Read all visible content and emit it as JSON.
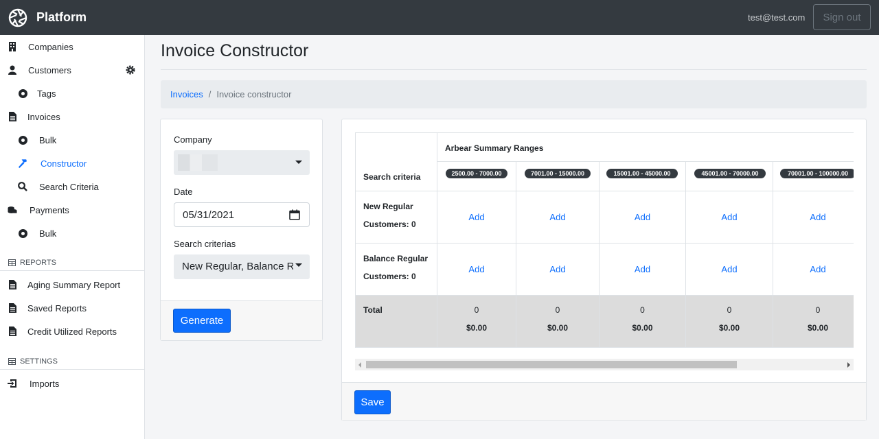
{
  "app": {
    "name": "Platform",
    "logo_icon": "aperture-icon"
  },
  "header": {
    "user_email": "test@test.com",
    "signout_label": "Sign out"
  },
  "sidebar": {
    "items": [
      {
        "label": "Companies",
        "icon": "building-icon"
      },
      {
        "label": "Customers",
        "icon": "user-icon",
        "settings_icon": "gear-icon"
      },
      {
        "label": "Tags",
        "icon": "circle-dot-icon"
      },
      {
        "label": "Invoices",
        "icon": "file-icon"
      },
      {
        "label": "Bulk",
        "icon": "circle-dot-icon"
      },
      {
        "label": "Constructor",
        "icon": "hammer-icon",
        "active": true
      },
      {
        "label": "Search Criteria",
        "icon": "search-icon"
      },
      {
        "label": "Payments",
        "icon": "coins-icon"
      },
      {
        "label": "Bulk",
        "icon": "circle-dot-icon"
      }
    ],
    "reports_heading": "REPORTS",
    "reports": [
      {
        "label": "Aging Summary Report",
        "icon": "file-icon"
      },
      {
        "label": "Saved Reports",
        "icon": "file-icon"
      },
      {
        "label": "Credit Utilized Reports",
        "icon": "file-icon"
      }
    ],
    "settings_heading": "SETTINGS",
    "settings": [
      {
        "label": "Imports",
        "icon": "import-icon"
      }
    ]
  },
  "page": {
    "title": "Invoice Constructor",
    "breadcrumb": {
      "parent": "Invoices",
      "separator": "/",
      "current": "Invoice constructor"
    }
  },
  "form": {
    "company_label": "Company",
    "company_value": "",
    "date_label": "Date",
    "date_value": "05/31/2021",
    "criteria_label": "Search criterias",
    "criteria_value": "New Regular, Balance Regular",
    "generate_label": "Generate"
  },
  "table": {
    "criteria_header": "Search criteria",
    "ranges_header": "Arbear Summary Ranges",
    "ranges": [
      "2500.00 - 7000.00",
      "7001.00 - 15000.00",
      "15001.00 - 45000.00",
      "45001.00 - 70000.00",
      "70001.00 - 100000.00"
    ],
    "rows": [
      {
        "name": "New Regular",
        "customers_label": "Customers: 0",
        "cells": [
          "Add",
          "Add",
          "Add",
          "Add",
          "Add"
        ]
      },
      {
        "name": "Balance Regular",
        "customers_label": "Customers: 0",
        "cells": [
          "Add",
          "Add",
          "Add",
          "Add",
          "Add"
        ]
      }
    ],
    "total_label": "Total",
    "totals": [
      {
        "count": "0",
        "amount": "$0.00"
      },
      {
        "count": "0",
        "amount": "$0.00"
      },
      {
        "count": "0",
        "amount": "$0.00"
      },
      {
        "count": "0",
        "amount": "$0.00"
      },
      {
        "count": "0",
        "amount": "$0.00"
      }
    ]
  },
  "save_label": "Save",
  "colors": {
    "topbar": "#343a40",
    "primary": "#0d6efd",
    "total_bg": "#dcdcdc"
  }
}
